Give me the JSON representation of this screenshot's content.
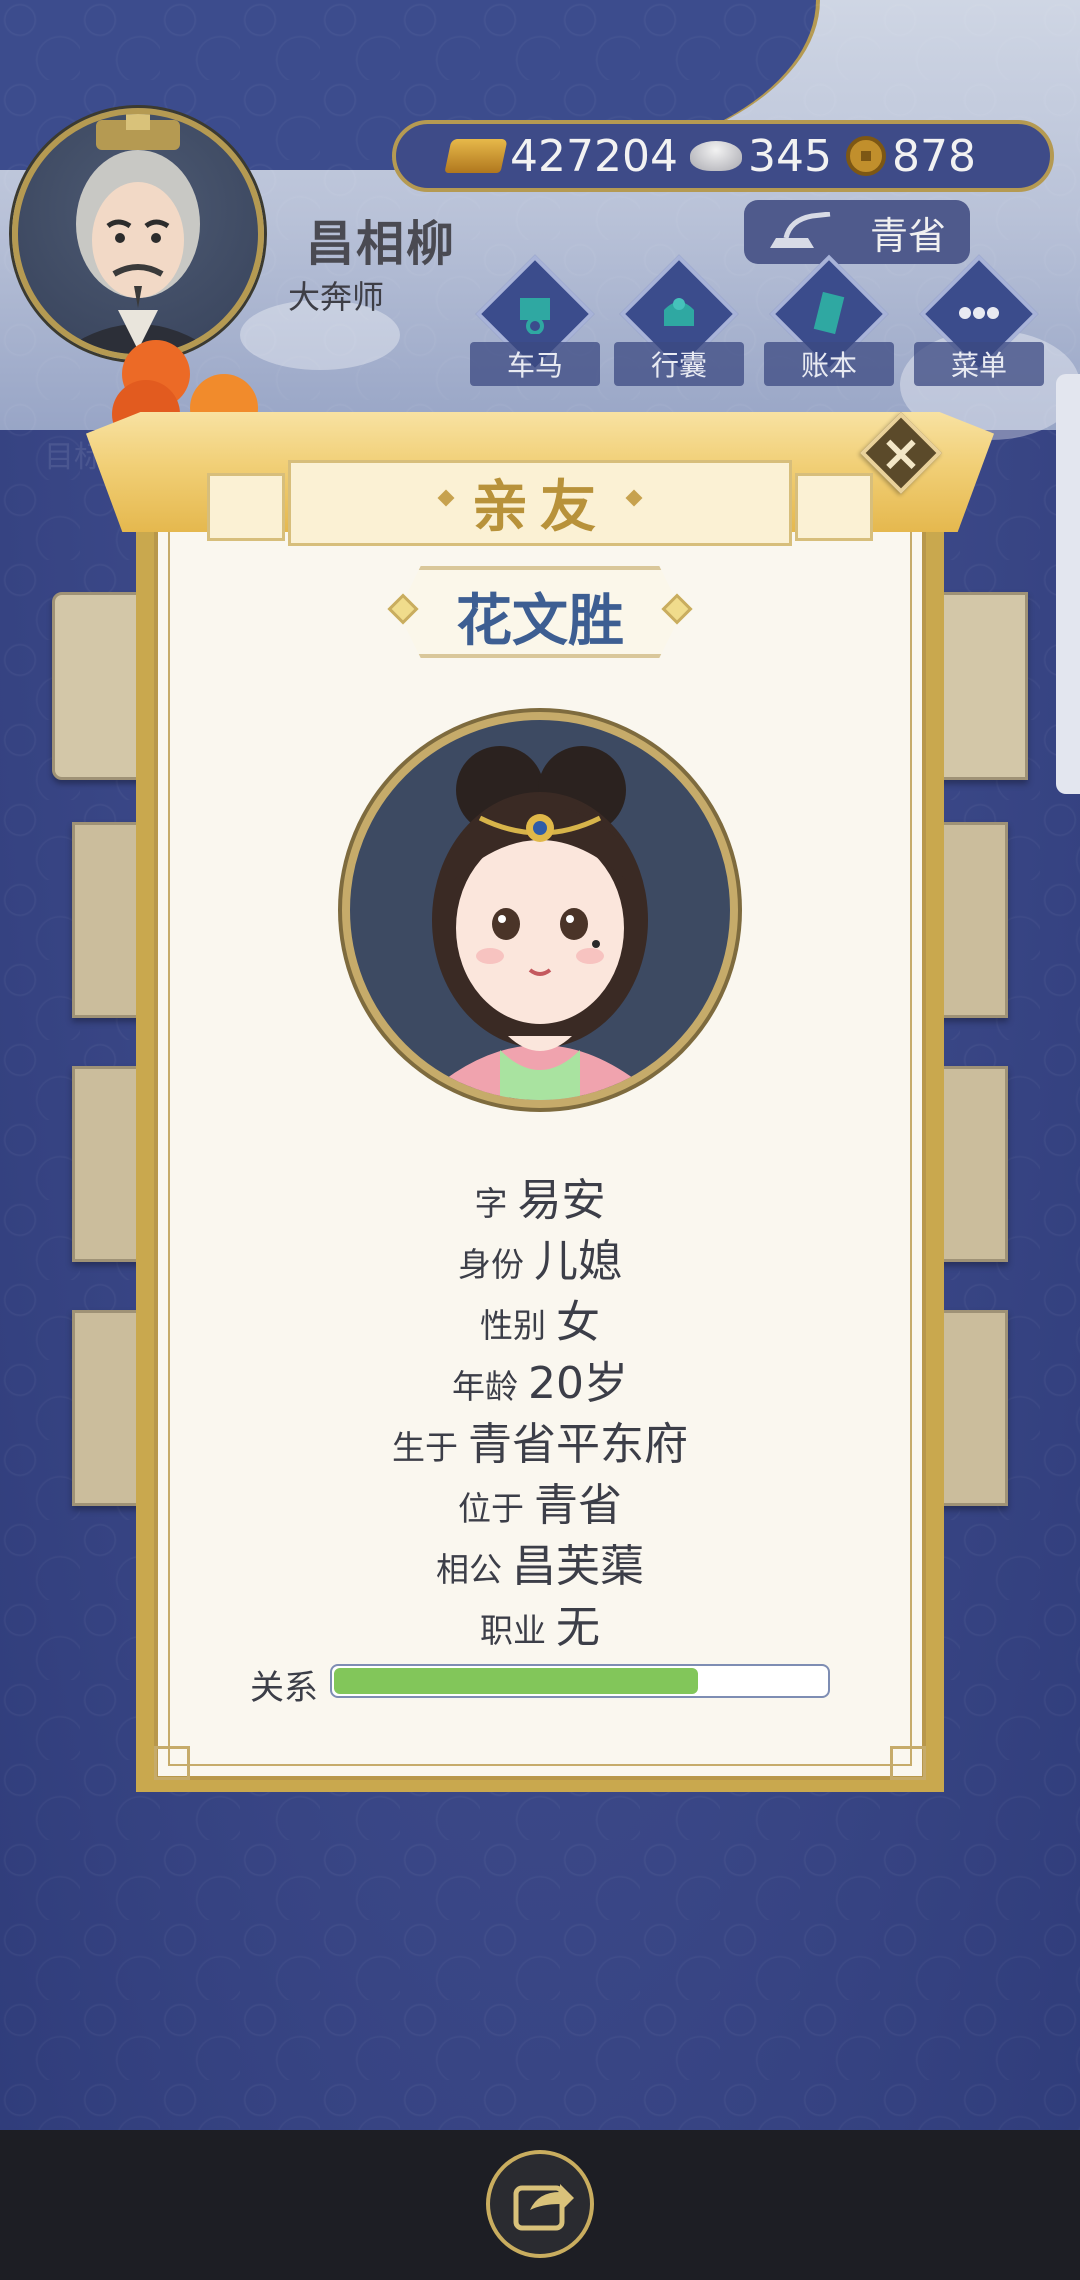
{
  "player": {
    "name": "昌相柳",
    "title": "大奔师"
  },
  "currency": {
    "gold": "427204",
    "silver": "345",
    "coins": "878"
  },
  "location": "青省",
  "menu": [
    {
      "label": "车马",
      "icon": "carriage-icon"
    },
    {
      "label": "行囊",
      "icon": "bag-icon"
    },
    {
      "label": "账本",
      "icon": "ledger-icon"
    },
    {
      "label": "菜单",
      "icon": "more-icon"
    }
  ],
  "goal_label": "目标",
  "modal": {
    "title": "亲友",
    "character_name": "花文胜",
    "fields": [
      {
        "key": "字",
        "value": "易安"
      },
      {
        "key": "身份",
        "value": "儿媳"
      },
      {
        "key": "性别",
        "value": "女"
      },
      {
        "key": "年龄",
        "value": "20岁"
      },
      {
        "key": "生于",
        "value": "青省平东府"
      },
      {
        "key": "位于",
        "value": "青省"
      },
      {
        "key": "相公",
        "value": "昌芙蕖"
      },
      {
        "key": "职业",
        "value": "无"
      }
    ],
    "relation_label": "关系",
    "relation_level": 0.74
  },
  "colors": {
    "accent_gold": "#c9a84e",
    "paper": "#faf7ef",
    "name_blue": "#3d5e92",
    "relation_green": "#82c65a"
  }
}
